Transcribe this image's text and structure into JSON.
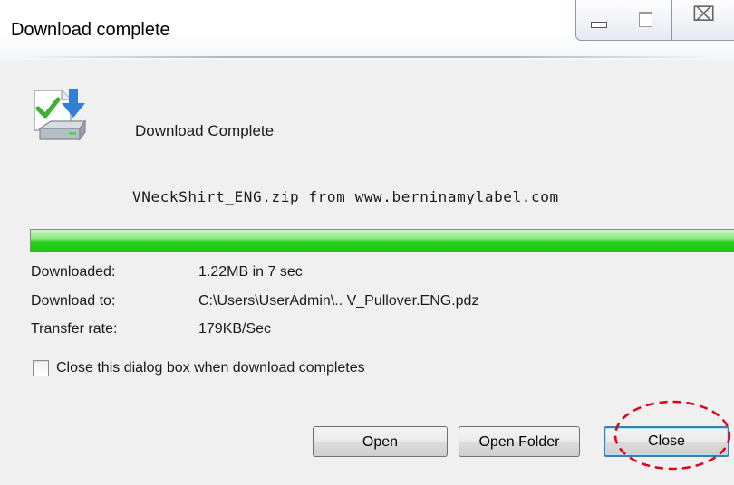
{
  "window": {
    "title": "Download complete",
    "controls": {
      "minimize": "minimize-icon",
      "maximize": "maximize-icon",
      "close": "close-icon"
    }
  },
  "dialog": {
    "icon": "download-to-disk-icon",
    "heading": "Download Complete",
    "source": "VNeckShirt_ENG.zip from www.berninamylabel.com",
    "progress_percent": 100,
    "progress_color": "#1fc713",
    "details": [
      {
        "label": "Downloaded:",
        "value": "1.22MB in 7 sec"
      },
      {
        "label": "Download to:",
        "value": "C:\\Users\\UserAdmin\\.. V_Pullover.ENG.pdz"
      },
      {
        "label": "Transfer rate:",
        "value": "179KB/Sec"
      }
    ],
    "close_on_complete": {
      "label": "Close this dialog box when download completes",
      "checked": false
    },
    "buttons": {
      "open": "Open",
      "open_folder": "Open Folder",
      "close": "Close"
    },
    "annotation_color": "#e0001b"
  }
}
